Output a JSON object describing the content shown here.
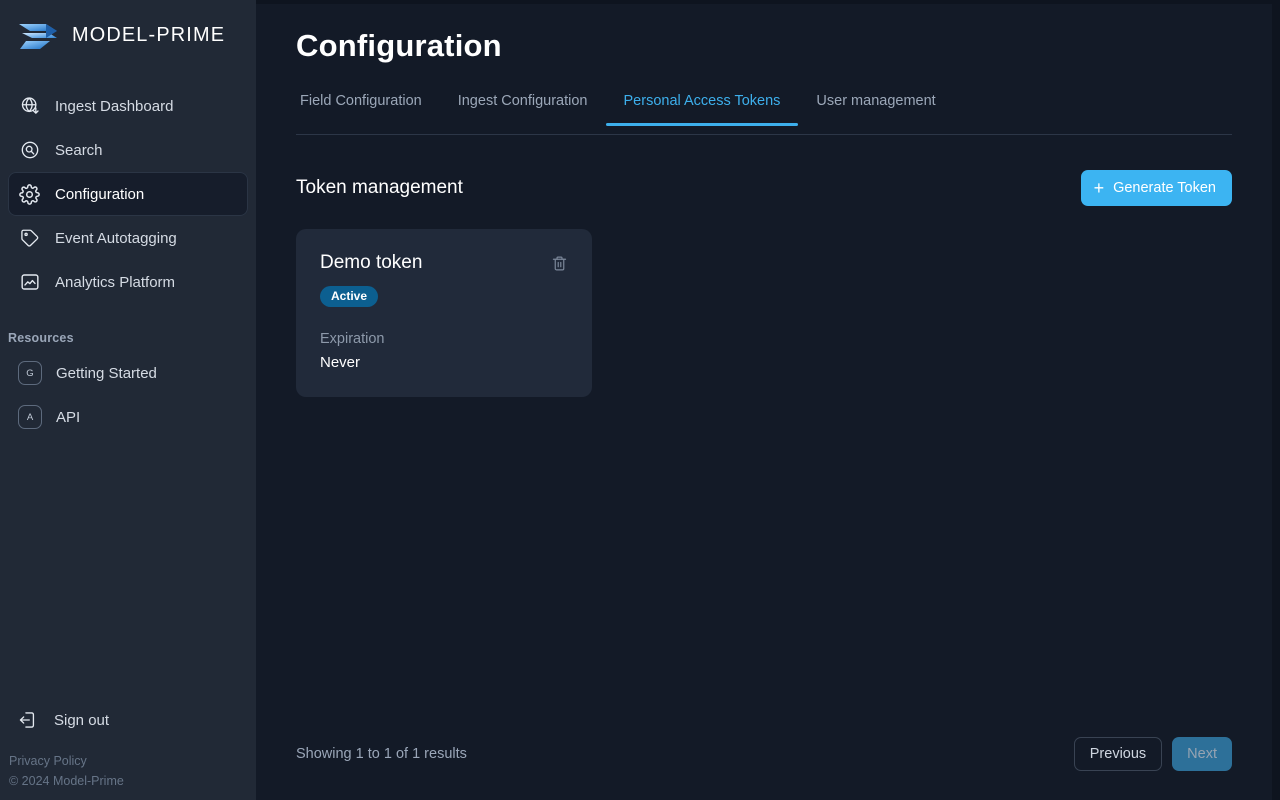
{
  "brand": {
    "name": "MODEL-PRIME"
  },
  "sidebar": {
    "items": [
      {
        "label": "Ingest Dashboard",
        "icon": "globe-download-icon",
        "active": false
      },
      {
        "label": "Search",
        "icon": "search-circle-icon",
        "active": false
      },
      {
        "label": "Configuration",
        "icon": "gear-icon",
        "active": true
      },
      {
        "label": "Event Autotagging",
        "icon": "tag-icon",
        "active": false
      },
      {
        "label": "Analytics Platform",
        "icon": "chart-image-icon",
        "active": false
      }
    ],
    "resources_title": "Resources",
    "resources": [
      {
        "badge": "G",
        "label": "Getting Started"
      },
      {
        "badge": "A",
        "label": "API"
      }
    ],
    "sign_out": "Sign out",
    "privacy_policy": "Privacy Policy",
    "copyright": "© 2024 Model-Prime"
  },
  "header": {
    "title": "Configuration"
  },
  "tabs": [
    {
      "label": "Field Configuration",
      "active": false
    },
    {
      "label": "Ingest Configuration",
      "active": false
    },
    {
      "label": "Personal Access Tokens",
      "active": true
    },
    {
      "label": "User management",
      "active": false
    }
  ],
  "section": {
    "title": "Token management",
    "generate_label": "Generate Token"
  },
  "tokens": [
    {
      "name": "Demo token",
      "status": "Active",
      "expiration_label": "Expiration",
      "expiration_value": "Never"
    }
  ],
  "footer": {
    "results": "Showing 1 to 1 of 1 results",
    "previous": "Previous",
    "next": "Next"
  },
  "colors": {
    "accent": "#3cb4f2",
    "sidebar_bg": "#212936",
    "main_bg": "#131a27",
    "card_bg": "#212a3a",
    "badge_bg": "#0c5f90",
    "next_bg": "#2d7099"
  }
}
